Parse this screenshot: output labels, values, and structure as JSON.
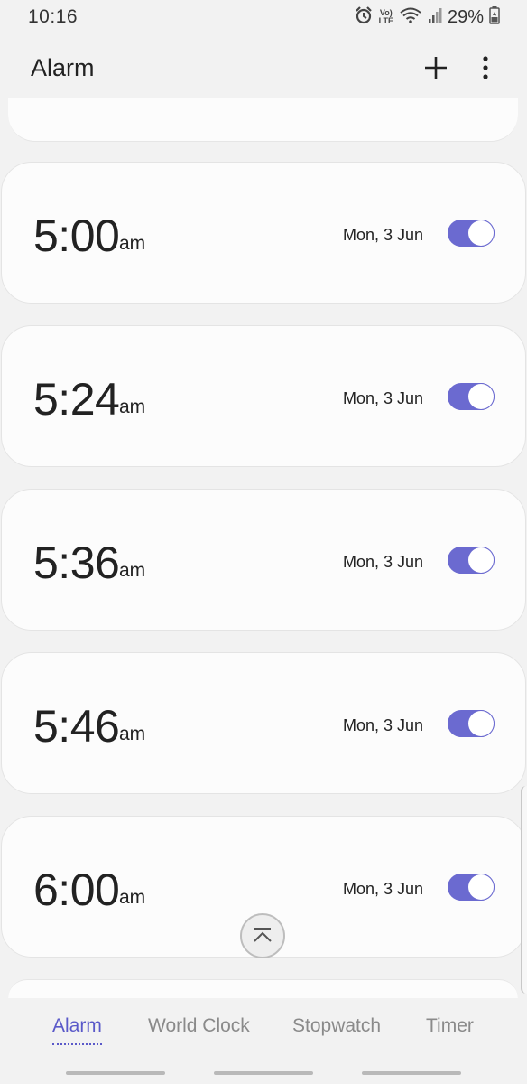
{
  "status_bar": {
    "time": "10:16",
    "network_label": "Vo) LTE",
    "battery_percent": "29%",
    "icons": [
      "alarm-clock-icon",
      "volte-icon",
      "wifi-icon",
      "signal-icon",
      "battery-charging-icon"
    ]
  },
  "header": {
    "title": "Alarm",
    "add_icon": "plus-icon",
    "more_icon": "more-vertical-icon"
  },
  "alarms": [
    {
      "time": "5:00",
      "ampm": "am",
      "date": "Mon, 3 Jun",
      "enabled": true
    },
    {
      "time": "5:24",
      "ampm": "am",
      "date": "Mon, 3 Jun",
      "enabled": true
    },
    {
      "time": "5:36",
      "ampm": "am",
      "date": "Mon, 3 Jun",
      "enabled": true
    },
    {
      "time": "5:46",
      "ampm": "am",
      "date": "Mon, 3 Jun",
      "enabled": true
    },
    {
      "time": "6:00",
      "ampm": "am",
      "date": "Mon, 3 Jun",
      "enabled": true
    }
  ],
  "scroll_top_icon": "chevron-up-bar-icon",
  "tabs": [
    {
      "label": "Alarm",
      "active": true
    },
    {
      "label": "World Clock",
      "active": false
    },
    {
      "label": "Stopwatch",
      "active": false
    },
    {
      "label": "Timer",
      "active": false
    }
  ],
  "colors": {
    "accent": "#6b6ad0",
    "background": "#f2f2f2",
    "card": "#fcfcfc"
  }
}
